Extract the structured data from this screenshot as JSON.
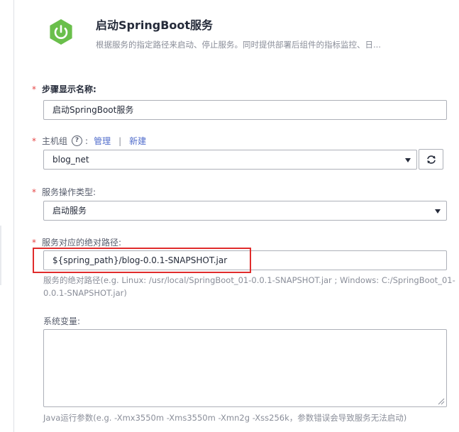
{
  "header": {
    "title": "启动SpringBoot服务",
    "description": "根据服务的指定路径来启动、停止服务。同时提供部署后组件的指标监控、日...",
    "logo_icon": "power-icon",
    "logo_color": "#6abf4b"
  },
  "form": {
    "step_name": {
      "required_mark": "*",
      "label": "步骤显示名称:",
      "value": "启动SpringBoot服务"
    },
    "host_group": {
      "required_mark": "*",
      "label": "主机组",
      "help_icon": "?",
      "colon": ":",
      "manage_link": "管理",
      "separator": "|",
      "new_link": "新建",
      "selected": "blog_net",
      "refresh_icon": "refresh-icon"
    },
    "service_action": {
      "required_mark": "*",
      "label": "服务操作类型:",
      "selected": "启动服务"
    },
    "service_path": {
      "required_mark": "*",
      "label": "服务对应的绝对路径:",
      "value": "${spring_path}/blog-0.0.1-SNAPSHOT.jar",
      "hint_line1": "服务的绝对路径(e.g. Linux: /usr/local/SpringBoot_01-0.0.1-SNAPSHOT.jar ; Windows: C:/SpringBoot_01-",
      "hint_line2": "0.0.1-SNAPSHOT.jar)"
    },
    "env_vars": {
      "label": "系统变量:",
      "value": "",
      "hint": "Java运行参数(e.g. -Xmx3550m -Xms3550m -Xmn2g -Xss256k，参数错误会导致服务无法启动)"
    }
  },
  "colors": {
    "required": "#e54545",
    "link": "#526ecc",
    "highlight": "#e02c2c"
  }
}
